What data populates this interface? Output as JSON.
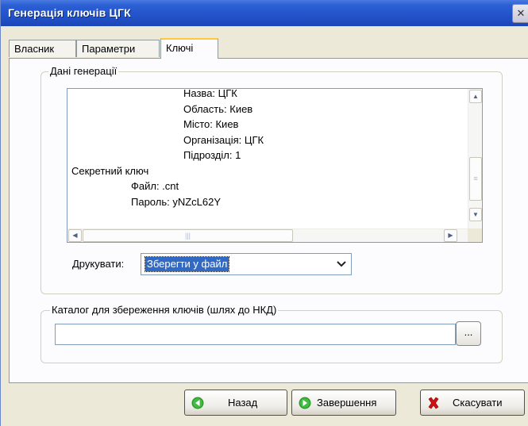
{
  "window": {
    "title": "Генерація ключів ЦГК",
    "close_icon": "close-icon"
  },
  "tabs": [
    {
      "label": "Власник"
    },
    {
      "label": "Параметри"
    },
    {
      "label": "Ключі",
      "active": true
    }
  ],
  "generation": {
    "legend": "Дані генерації",
    "lines": [
      "Назва: ЦГК",
      "Область: Киев",
      "Місто: Киев",
      "Організація: ЦГК",
      "Підрозділ: 1",
      "Секретний ключ",
      "Файл: .cnt",
      "Пароль: yNZcL62Y"
    ]
  },
  "print": {
    "label": "Друкувати:",
    "selected": "Зберегти у файл"
  },
  "catalog": {
    "legend": "Каталог для збереження ключів (шлях до НКД)",
    "value": "",
    "browse_label": "..."
  },
  "buttons": {
    "back": "Назад",
    "finish": "Завершення",
    "cancel": "Скасувати"
  },
  "colors": {
    "titlebar": "#2352c9",
    "selection": "#316ac5",
    "tab_highlight": "#ffc83c"
  }
}
